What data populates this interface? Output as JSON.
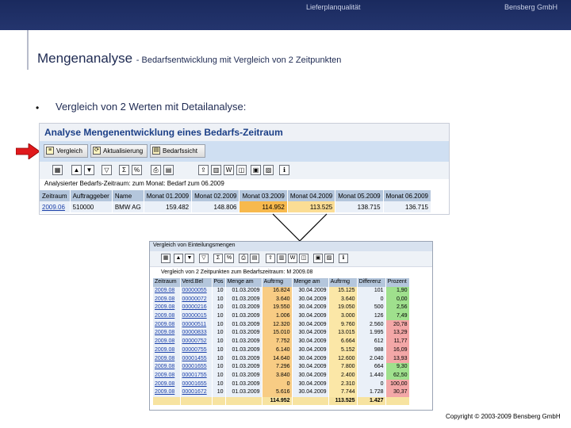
{
  "header": {
    "center": "Lieferplanqualität",
    "right": "Bensberg GmbH"
  },
  "slide": {
    "title": "Mengenanalyse",
    "subtitle": "- Bedarfsentwicklung mit Vergleich von 2 Zeitpunkten",
    "bullet": "•",
    "bullet_text": "Vergleich von 2 Werten mit Detailanalyse:"
  },
  "window1": {
    "title": "Analyse Mengenentwicklung eines Bedarfs-Zeitraum",
    "buttons": [
      "Vergleich",
      "Aktualisierung",
      "Bedarfssicht"
    ],
    "info": "Analysierter Bedarfs-Zeitraum: zum Monat: Bedarf zum 06.2009",
    "columns": [
      "Zeitraum",
      "Auftraggeber",
      "Name",
      "Monat 01.2009",
      "Monat 02.2009",
      "Monat 03.2009",
      "Monat 04.2009",
      "Monat 05.2009",
      "Monat 06.2009"
    ],
    "row": [
      "2009.06",
      "510000",
      "BMW AG",
      "159.482",
      "148.806",
      "114.952",
      "113.525",
      "138.715",
      "136.715"
    ]
  },
  "window2": {
    "title": "Vergleich von Einteilungsmengen",
    "info": "Vergleich von 2 Zeitpunkten zum Bedarfszeitraum: M 2009.08",
    "columns": [
      "Zeitraum",
      "Verd.Bel",
      "Pos",
      "Menge am",
      "Auftrmg",
      "Menge am",
      "Auftrmg",
      "Differenz",
      "Prozent"
    ],
    "rows": [
      [
        "2009.08",
        "00000055",
        "10",
        "01.03.2009",
        "16.824",
        "30.04.2009",
        "15.125",
        "101",
        "1,90"
      ],
      [
        "2009.08",
        "00000072",
        "10",
        "01.03.2009",
        "3.640",
        "30.04.2009",
        "3.640",
        "0",
        "0,00"
      ],
      [
        "2009.08",
        "00000216",
        "10",
        "01.03.2009",
        "19.550",
        "30.04.2009",
        "19.050",
        "500",
        "2,56"
      ],
      [
        "2009.08",
        "00000015",
        "10",
        "01.03.2009",
        "1.006",
        "30.04.2009",
        "3.000",
        "126",
        "7,49"
      ],
      [
        "2009.08",
        "00000511",
        "10",
        "01.03.2009",
        "12.320",
        "30.04.2009",
        "9.760",
        "2.560",
        "20,78"
      ],
      [
        "2009.08",
        "00000833",
        "10",
        "01.03.2009",
        "15.010",
        "30.04.2009",
        "13.015",
        "1.995",
        "13,29"
      ],
      [
        "2009.08",
        "00000752",
        "10",
        "01.03.2009",
        "7.752",
        "30.04.2009",
        "6.664",
        "612",
        "11,77"
      ],
      [
        "2009.08",
        "00000755",
        "10",
        "01.03.2009",
        "6.140",
        "30.04.2009",
        "5.152",
        "988",
        "16,09"
      ],
      [
        "2009.08",
        "00001455",
        "10",
        "01.03.2009",
        "14.640",
        "30.04.2009",
        "12.600",
        "2.040",
        "13,93"
      ],
      [
        "2009.08",
        "00001655",
        "10",
        "01.03.2009",
        "7.296",
        "30.04.2009",
        "7.800",
        "664",
        "9,30"
      ],
      [
        "2009.08",
        "00001755",
        "10",
        "01.03.2009",
        "3.840",
        "30.04.2009",
        "2.400",
        "1.440",
        "62,50"
      ],
      [
        "2009.08",
        "00001655",
        "10",
        "01.03.2009",
        "0",
        "30.04.2009",
        "2.310",
        "0",
        "100,00"
      ],
      [
        "2009.08",
        "00001672",
        "10",
        "01.03.2009",
        "5.616",
        "30.04.2009",
        "7.744",
        "1.728",
        "30,37"
      ]
    ],
    "row_classes": [
      "pos",
      "pos",
      "pos",
      "pos",
      "neg",
      "neg",
      "neg",
      "neg",
      "neg",
      "pos",
      "pos",
      "neg",
      "neg"
    ],
    "totals": [
      "",
      "",
      "",
      "",
      "114.952",
      "",
      "113.525",
      "1.427",
      ""
    ]
  },
  "copyright": "Copyright © 2003-2009 Bensberg GmbH",
  "colors": {
    "navy": "#1e2a52",
    "sap_blue": "#cfdff2",
    "highlight": "#f7b94d"
  }
}
